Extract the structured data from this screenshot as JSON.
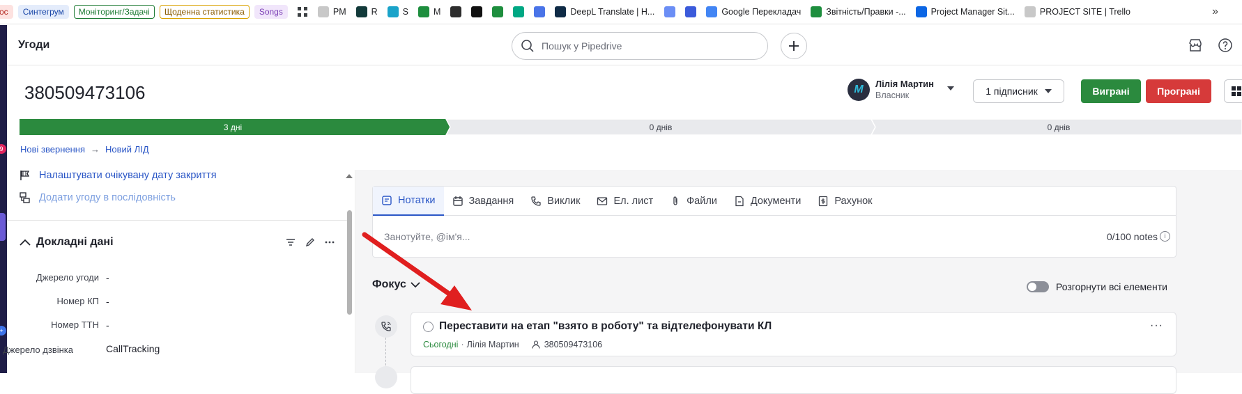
{
  "bookmarks": {
    "chips": [
      {
        "label": "ос",
        "bg": "#fde2e0",
        "fg": "#b3261e",
        "border": "#fde2e0"
      },
      {
        "label": "Синтегрум",
        "bg": "#e4ecfb",
        "fg": "#1a47a8",
        "border": "#e4ecfb"
      },
      {
        "label": "Моніторинг/Задачі",
        "bg": "#ffffff",
        "fg": "#1e7b34",
        "border": "#1e7b34"
      },
      {
        "label": "Щоденна статистика",
        "bg": "#ffffff",
        "fg": "#8a5a00",
        "border": "#d9a200"
      },
      {
        "label": "Songs",
        "bg": "#f1e6fb",
        "fg": "#7b3fb5",
        "border": "#f1e6fb"
      }
    ],
    "items": [
      {
        "label": "PM",
        "icon": "pm-icon",
        "color": "#c8c8c8"
      },
      {
        "label": "R",
        "icon": "r-icon",
        "color": "#123a3a"
      },
      {
        "label": "S",
        "icon": "m-icon",
        "color": "#1aa3c9"
      },
      {
        "label": "M",
        "icon": "sheets-icon",
        "color": "#1e8e3e"
      },
      {
        "label": "",
        "icon": "openai-icon",
        "color": "#2d2d2d"
      },
      {
        "label": "",
        "icon": "dark-app-icon",
        "color": "#111111"
      },
      {
        "label": "",
        "icon": "chat-icon",
        "color": "#1e8e3e"
      },
      {
        "label": "",
        "icon": "play-icon",
        "color": "#00a884"
      },
      {
        "label": "",
        "icon": "heart-icon",
        "color": "#4a74e8"
      },
      {
        "label": "DeepL Translate | H...",
        "icon": "deepl-icon",
        "color": "#0f2b46"
      },
      {
        "label": "",
        "icon": "gemini-icon",
        "color": "#6b8ef5"
      },
      {
        "label": "",
        "icon": "podcast-icon",
        "color": "#3b5bdb"
      },
      {
        "label": "Google Перекладач",
        "icon": "translate-icon",
        "color": "#4285f4"
      },
      {
        "label": "Звітність/Правки -...",
        "icon": "sheets-icon",
        "color": "#1e8e3e"
      },
      {
        "label": "Project Manager Sit...",
        "icon": "trello-icon",
        "color": "#0c66e4"
      },
      {
        "label": "PROJECT SITE | Trello",
        "icon": "pm-icon",
        "color": "#c8c8c8"
      }
    ],
    "more": "»"
  },
  "rail": {
    "badge_top": "9"
  },
  "header": {
    "title": "Угоди",
    "search_placeholder": "Пошук у Pipedrive"
  },
  "deal": {
    "title": "380509473106",
    "owner_name": "Лілія Мартин",
    "owner_role": "Власник",
    "owner_initial": "M",
    "followers": "1 підписник",
    "won": "Виграні",
    "lost": "Програні"
  },
  "pipeline": {
    "stages": [
      {
        "label": "3 дні",
        "active": true
      },
      {
        "label": "0 днів",
        "active": false
      },
      {
        "label": "0 днів",
        "active": false
      }
    ]
  },
  "breadcrumb": {
    "from": "Нові звернення",
    "to": "Новий ЛІД"
  },
  "left_panel": {
    "set_close_date": "Налаштувати очікувану дату закриття",
    "add_sequence": "Додати угоду в послідовність",
    "section_title": "Докладні дані",
    "fields": [
      {
        "label": "Джерело угоди",
        "value": "-"
      },
      {
        "label": "Номер КП",
        "value": "-"
      },
      {
        "label": "Номер ТТН",
        "value": "-"
      },
      {
        "label": "Джерело дзвінка",
        "value": "CallTracking"
      }
    ]
  },
  "composer": {
    "tabs": [
      {
        "label": "Нотатки",
        "icon": "note-icon"
      },
      {
        "label": "Завдання",
        "icon": "calendar-icon"
      },
      {
        "label": "Виклик",
        "icon": "phone-icon"
      },
      {
        "label": "Ел. лист",
        "icon": "mail-icon"
      },
      {
        "label": "Файли",
        "icon": "paperclip-icon"
      },
      {
        "label": "Документи",
        "icon": "document-icon"
      },
      {
        "label": "Рахунок",
        "icon": "invoice-icon"
      }
    ],
    "placeholder": "Занотуйте, @ім'я...",
    "count": "0/100 notes"
  },
  "focus": {
    "title": "Фокус",
    "expand_all": "Розгорнути всі елементи"
  },
  "activity": {
    "title": "Переставити на етап \"взято в роботу\" та відтелефонувати КЛ",
    "due": "Сьогодні",
    "owner": "Лілія Мартин",
    "person": "380509473106"
  },
  "colors": {
    "accent": "#2a56c6",
    "won": "#2b8a3e",
    "lost": "#d63a3a",
    "annotation_arrow": "#e01f1f"
  }
}
